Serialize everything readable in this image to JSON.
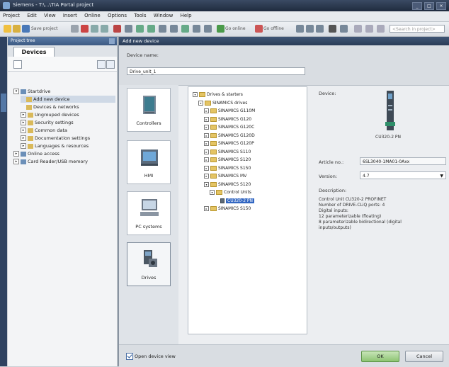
{
  "window": {
    "title": "Siemens - T:\\...\\TIA Portal project"
  },
  "menu": [
    "Project",
    "Edit",
    "View",
    "Insert",
    "Online",
    "Options",
    "Tools",
    "Window",
    "Help"
  ],
  "toolbar": {
    "save_label": "Save project",
    "online_label": "Go online",
    "offline_label": "Go offline",
    "search_placeholder": "<Search in project>"
  },
  "project_tree": {
    "header": "Project tree",
    "tab": "Devices",
    "items": [
      {
        "label": "Startdrive",
        "level": 0,
        "expander": "▾"
      },
      {
        "label": "Add new device",
        "level": 1,
        "expander": "",
        "selected": true
      },
      {
        "label": "Devices & networks",
        "level": 1,
        "expander": ""
      },
      {
        "label": "Ungrouped devices",
        "level": 1,
        "expander": "▸"
      },
      {
        "label": "Security settings",
        "level": 1,
        "expander": "▸"
      },
      {
        "label": "Common data",
        "level": 1,
        "expander": "▸"
      },
      {
        "label": "Documentation settings",
        "level": 1,
        "expander": "▸"
      },
      {
        "label": "Languages & resources",
        "level": 1,
        "expander": "▸"
      },
      {
        "label": "Online access",
        "level": 0,
        "expander": "▸"
      },
      {
        "label": "Card Reader/USB memory",
        "level": 0,
        "expander": "▸"
      }
    ]
  },
  "dialog": {
    "title": "Add new device",
    "device_name_label": "Device name:",
    "device_name_value": "Drive_unit_1",
    "categories": [
      {
        "label": "Controllers",
        "icon": "controller-icon"
      },
      {
        "label": "HMI",
        "icon": "hmi-icon"
      },
      {
        "label": "PC systems",
        "icon": "pc-icon"
      },
      {
        "label": "Drives",
        "icon": "drive-icon",
        "active": true
      }
    ],
    "device_tree": [
      {
        "label": "Drives & starters",
        "level": 0,
        "expander": "▾"
      },
      {
        "label": "SINAMICS drives",
        "level": 1,
        "expander": "▾"
      },
      {
        "label": "SINAMICS G110M",
        "level": 2,
        "expander": "▸"
      },
      {
        "label": "SINAMICS G120",
        "level": 2,
        "expander": "▸"
      },
      {
        "label": "SINAMICS G120C",
        "level": 2,
        "expander": "▸"
      },
      {
        "label": "SINAMICS G120D",
        "level": 2,
        "expander": "▸"
      },
      {
        "label": "SINAMICS G120P",
        "level": 2,
        "expander": "▸"
      },
      {
        "label": "SINAMICS S110",
        "level": 2,
        "expander": "▸"
      },
      {
        "label": "SINAMICS S120",
        "level": 2,
        "expander": "▸"
      },
      {
        "label": "SINAMICS S150",
        "level": 2,
        "expander": "▸"
      },
      {
        "label": "SINAMICS MV",
        "level": 2,
        "expander": "▸"
      },
      {
        "label": "SINAMICS S120",
        "level": 2,
        "expander": "▾"
      },
      {
        "label": "Control Units",
        "level": 3,
        "expander": "▾"
      },
      {
        "label": "CU320-2 PN",
        "level": 4,
        "expander": "",
        "highlight": true
      },
      {
        "label": "SINAMICS S150",
        "level": 2,
        "expander": "▸"
      }
    ],
    "info": {
      "device_label": "Device:",
      "device_name": "CU320-2 PN",
      "article_label": "Article no.:",
      "article_value": "6SL3040-1MA01-0Axx",
      "version_label": "Version:",
      "version_value": "4.7",
      "description_label": "Description:",
      "description_lines": [
        "Control Unit CU320-2 PROFINET",
        "Number of DRIVE-CLiQ ports: 4",
        "Digital inputs:",
        "12 parameterizable (floating)",
        "8 parameterizable bidirectional (digital",
        "inputs/outputs)"
      ]
    },
    "open_device_view_label": "Open device view",
    "ok_label": "OK",
    "cancel_label": "Cancel"
  }
}
